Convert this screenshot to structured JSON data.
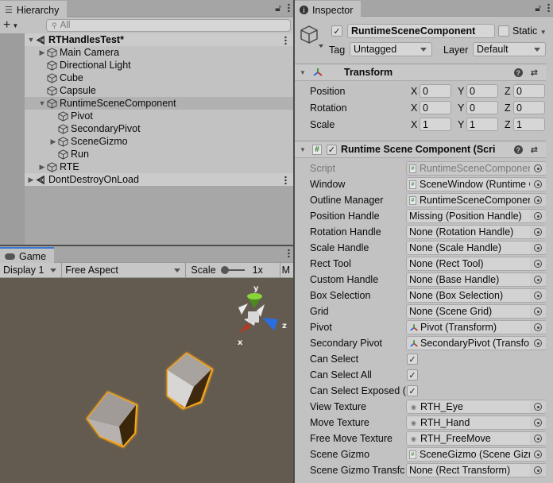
{
  "hierarchy": {
    "tab_label": "Hierarchy",
    "search_placeholder": "All",
    "items": [
      {
        "label": "RTHandlesTest*",
        "type": "scene",
        "expanded": true
      },
      {
        "label": "Main Camera",
        "type": "object",
        "expandable": true
      },
      {
        "label": "Directional Light",
        "type": "object"
      },
      {
        "label": "Cube",
        "type": "object"
      },
      {
        "label": "Capsule",
        "type": "object"
      },
      {
        "label": "RuntimeSceneComponent",
        "type": "object",
        "expanded": true,
        "selected": true
      },
      {
        "label": "Pivot",
        "type": "object"
      },
      {
        "label": "SecondaryPivot",
        "type": "object"
      },
      {
        "label": "SceneGizmo",
        "type": "object",
        "expandable": true
      },
      {
        "label": "Run",
        "type": "object"
      },
      {
        "label": "RTE",
        "type": "object",
        "expandable": true
      },
      {
        "label": "DontDestroyOnLoad",
        "type": "scene"
      }
    ]
  },
  "game": {
    "tab_label": "Game",
    "display": "Display 1",
    "aspect": "Free Aspect",
    "scale_label": "Scale",
    "scale_value": "1x",
    "truncated_next": "M",
    "gizmo_labels": {
      "x": "x",
      "y": "y",
      "z": "z"
    },
    "colors": {
      "background": "#645b50",
      "outline": "#f5a015",
      "x_axis": "#b03a22",
      "y_axis": "#8ad63a",
      "z_axis": "#2a6ee0"
    }
  },
  "inspector": {
    "tab_label": "Inspector",
    "object_name": "RuntimeSceneComponent",
    "active": true,
    "static_label": "Static",
    "static": false,
    "tag_label": "Tag",
    "tag_value": "Untagged",
    "layer_label": "Layer",
    "layer_value": "Default",
    "transform": {
      "title": "Transform",
      "rows": [
        {
          "label": "Position",
          "x": "0",
          "y": "0",
          "z": "0"
        },
        {
          "label": "Rotation",
          "x": "0",
          "y": "0",
          "z": "0"
        },
        {
          "label": "Scale",
          "x": "1",
          "y": "1",
          "z": "1"
        }
      ],
      "axis_x": "X",
      "axis_y": "Y",
      "axis_z": "Z"
    },
    "component": {
      "title": "Runtime Scene Component (Scrip",
      "enabled": true,
      "props": [
        {
          "label": "Script",
          "value": "RuntimeSceneComponen",
          "icon": "script",
          "disabled": true
        },
        {
          "label": "Window",
          "value": "SceneWindow (Runtime C",
          "icon": "script"
        },
        {
          "label": "Outline Manager",
          "value": "RuntimeSceneComponen",
          "icon": "script"
        },
        {
          "label": "Position Handle",
          "value": "Missing (Position Handle)"
        },
        {
          "label": "Rotation Handle",
          "value": "None (Rotation Handle)"
        },
        {
          "label": "Scale Handle",
          "value": "None (Scale Handle)"
        },
        {
          "label": "Rect Tool",
          "value": "None (Rect Tool)"
        },
        {
          "label": "Custom Handle",
          "value": "None (Base Handle)"
        },
        {
          "label": "Box Selection",
          "value": "None (Box Selection)"
        },
        {
          "label": "Grid",
          "value": "None (Scene Grid)"
        },
        {
          "label": "Pivot",
          "value": "Pivot (Transform)",
          "icon": "transform"
        },
        {
          "label": "Secondary Pivot",
          "value": "SecondaryPivot (Transfor",
          "icon": "transform"
        },
        {
          "label": "Can Select",
          "checkbox": true
        },
        {
          "label": "Can Select All",
          "checkbox": true
        },
        {
          "label": "Can Select Exposed (",
          "checkbox": true
        },
        {
          "label": "View Texture",
          "value": "RTH_Eye",
          "icon": "texture"
        },
        {
          "label": "Move Texture",
          "value": "RTH_Hand",
          "icon": "texture"
        },
        {
          "label": "Free Move Texture",
          "value": "RTH_FreeMove",
          "icon": "texture"
        },
        {
          "label": "Scene Gizmo",
          "value": "SceneGizmo (Scene Gizn",
          "icon": "script"
        },
        {
          "label": "Scene Gizmo Transfc",
          "value": "None (Rect Transform)"
        }
      ]
    }
  }
}
